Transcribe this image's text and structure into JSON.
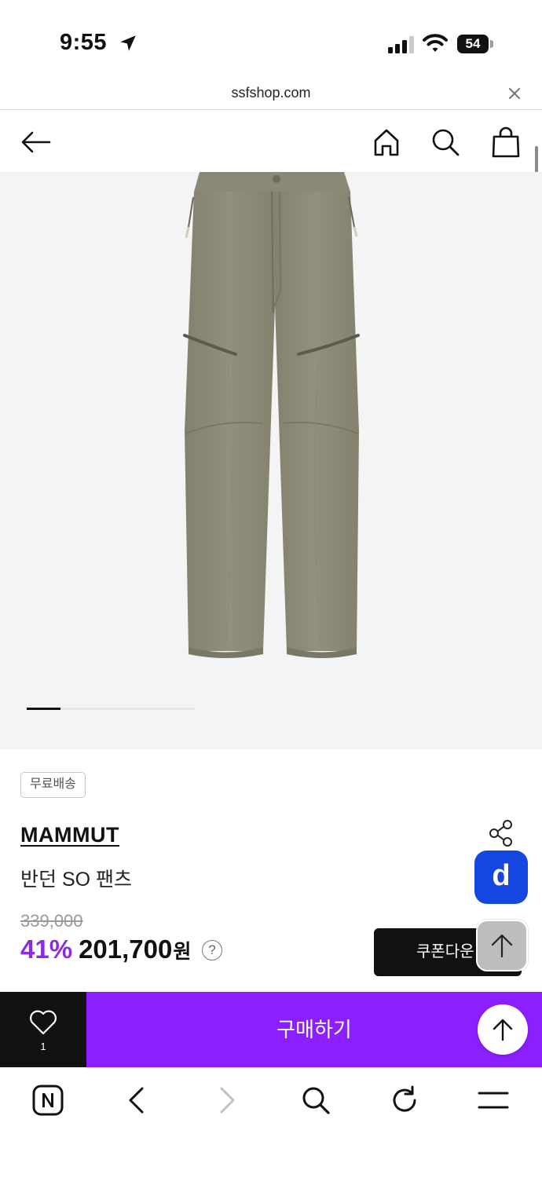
{
  "status_bar": {
    "time": "9:55",
    "battery": "54"
  },
  "address_bar": {
    "url": "ssfshop.com"
  },
  "header": {
    "back_icon": "arrow-left-icon",
    "home_icon": "home-icon",
    "search_icon": "search-icon",
    "bag_icon": "shopping-bag-icon"
  },
  "gallery": {
    "current_index": 1,
    "total_images": 5
  },
  "product": {
    "badge": "무료배송",
    "brand": "MAMMUT",
    "name": "반던 SO 팬츠",
    "original_price": "339,000",
    "discount": "41%",
    "sale_price": "201,700",
    "currency": "원",
    "help": "?"
  },
  "actions": {
    "coupon_label": "쿠폰다운",
    "d_label": "d",
    "wish_count": "1",
    "buy_label": "구매하기"
  },
  "colors": {
    "accent_purple": "#8c1fff",
    "discount_purple": "#8a2be2",
    "d_blue": "#1546e0",
    "pants_khaki": "#8d8a77"
  }
}
